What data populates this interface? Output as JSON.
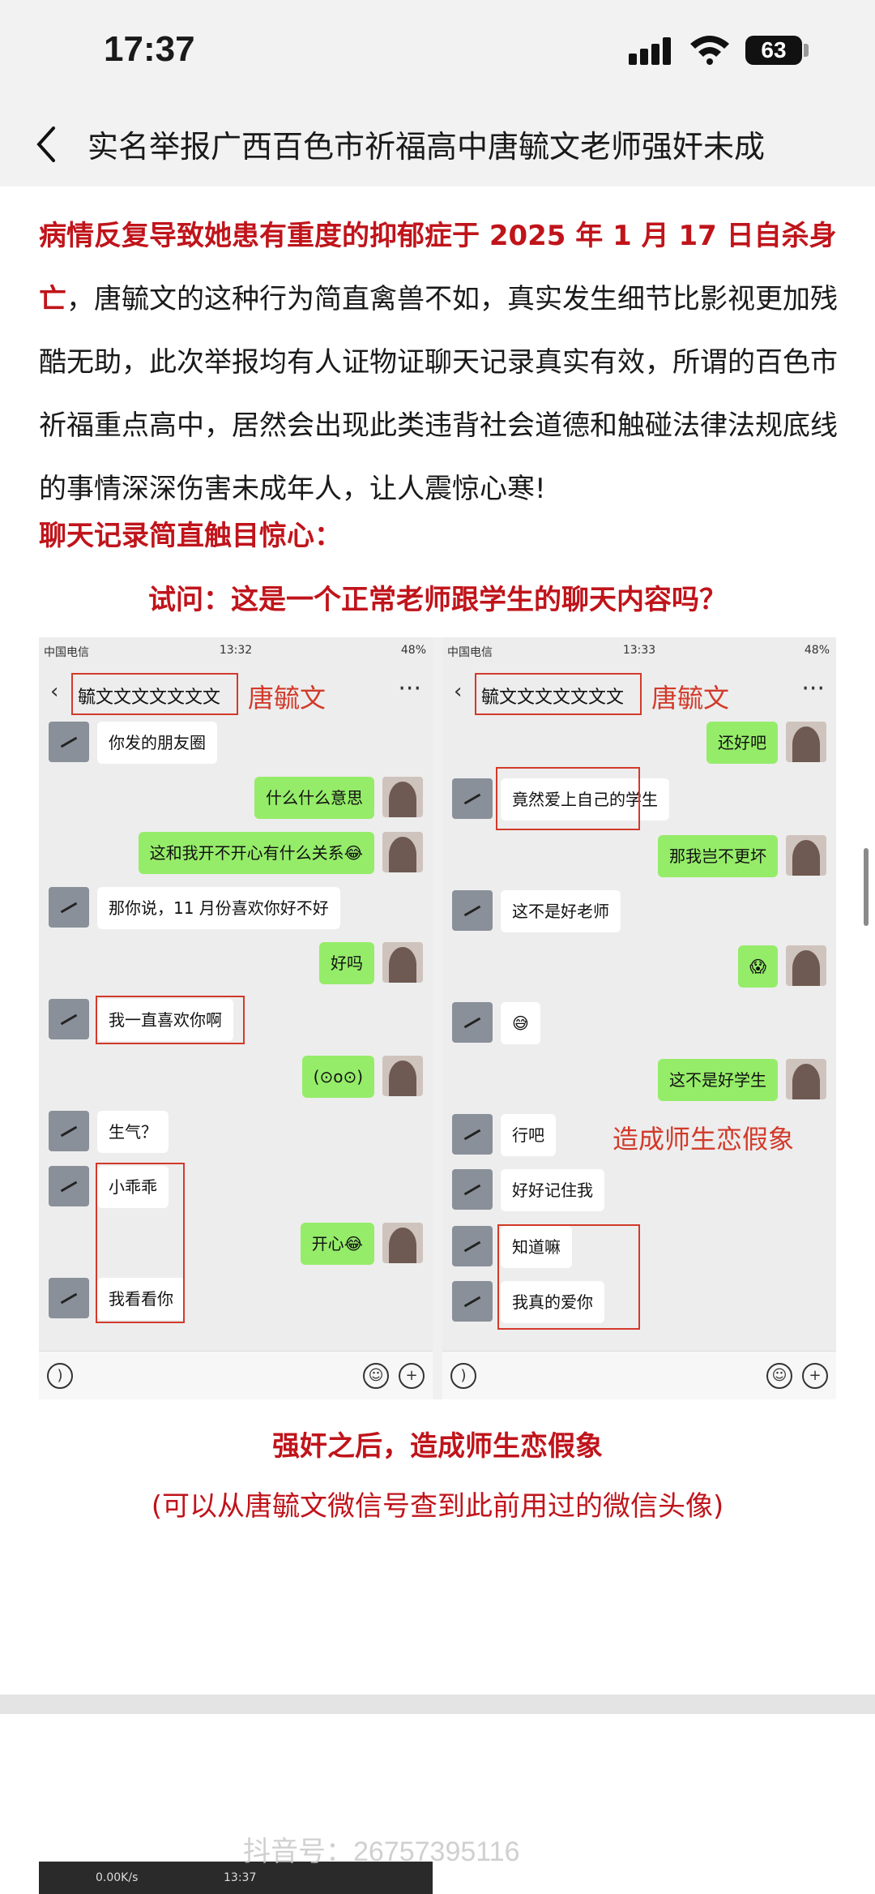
{
  "status_bar": {
    "time": "17:37",
    "battery": "63"
  },
  "nav": {
    "title": "实名举报广西百色市祈福高中唐毓文老师强奸未成"
  },
  "article": {
    "p1_red": "病情反复导致她患有重度的抑郁症于 2025 年 1 月 17 日自杀身亡",
    "p1_rest": "，唐毓文的这种行为简直禽兽不如，真实发生细节比影视更加残酷无助，此次举报均有人证物证聊天记录真实有效，所谓的百色市祈福重点高中，居然会出现此类违背社会道德和触碰法律法规底线的事情深深伤害未成年人，让人震惊心寒!",
    "subhead": "聊天记录简直触目惊心：",
    "question": "试问：这是一个正常老师跟学生的聊天内容吗？",
    "caption1": "强奸之后，造成师生恋假象",
    "caption2": "(可以从唐毓文微信号查到此前用过的微信头像)"
  },
  "screenshot_left": {
    "status_left": "中国电信",
    "status_time": "13:32",
    "status_battery": "48%",
    "contact": "毓文文文文文文文",
    "label": "唐毓文",
    "messages": [
      "你发的朋友圈",
      "什么什么意思",
      "这和我开不开心有什么关系😂",
      "那你说，11 月份喜欢你好不好",
      "好吗",
      "我一直喜欢你啊",
      "(⊙o⊙)",
      "生气？",
      "小乖乖",
      "开心😂",
      "我看看你"
    ]
  },
  "screenshot_right": {
    "status_left": "中国电信",
    "status_time": "13:33",
    "status_battery": "48%",
    "contact": "毓文文文文文文文",
    "label": "唐毓文",
    "messages": [
      "还好吧",
      "竟然爱上自己的学生",
      "那我岂不更坏",
      "这不是好老师",
      "😱",
      "😅",
      "这不是好学生",
      "行吧",
      "好好记住我",
      "知道嘛",
      "我真的爱你"
    ],
    "annotation": "造成师生恋假象"
  },
  "bottom": {
    "status_left": "0.00K/s",
    "status_time": "13:37",
    "watermark": "抖音号：26757395116"
  }
}
